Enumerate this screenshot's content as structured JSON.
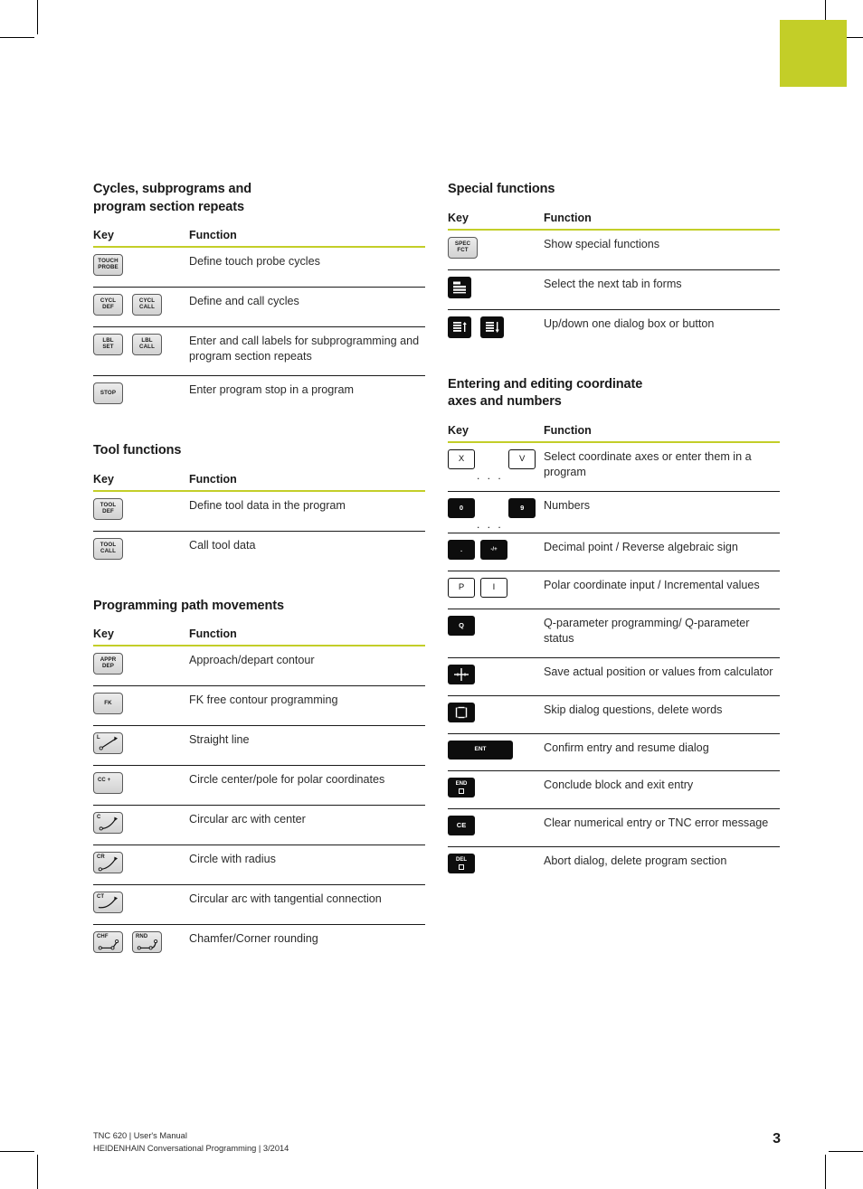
{
  "theme": {
    "accent": "#c3ce28",
    "rule": "#1a1a1a",
    "gray_key_fill": "#dcdcdc",
    "black_key_fill": "#0d0d0d",
    "text": "#1a1a1a"
  },
  "table_headers": {
    "key": "Key",
    "function": "Function"
  },
  "left_column": {
    "sections": [
      {
        "title": "Cycles, subprograms and\nprogram section repeats",
        "rows": [
          {
            "keys": [
              {
                "style": "gray",
                "lines": [
                  "TOUCH",
                  "PROBE"
                ]
              }
            ],
            "function": "Define touch probe cycles"
          },
          {
            "keys": [
              {
                "style": "gray",
                "lines": [
                  "CYCL",
                  "DEF"
                ]
              },
              {
                "style": "gray",
                "lines": [
                  "CYCL",
                  "CALL"
                ]
              }
            ],
            "function": "Define and call cycles"
          },
          {
            "keys": [
              {
                "style": "gray",
                "lines": [
                  "LBL",
                  "SET"
                ]
              },
              {
                "style": "gray",
                "lines": [
                  "LBL",
                  "CALL"
                ]
              }
            ],
            "function": "Enter and call labels for subprogramming and program section repeats"
          },
          {
            "keys": [
              {
                "style": "gray",
                "lines": [
                  "STOP"
                ]
              }
            ],
            "function": "Enter program stop in a program"
          }
        ]
      },
      {
        "title": "Tool functions",
        "rows": [
          {
            "keys": [
              {
                "style": "gray",
                "lines": [
                  "TOOL",
                  "DEF"
                ]
              }
            ],
            "function": "Define tool data in the program"
          },
          {
            "keys": [
              {
                "style": "gray",
                "lines": [
                  "TOOL",
                  "CALL"
                ]
              }
            ],
            "function": "Call tool data"
          }
        ]
      },
      {
        "title": "Programming path movements",
        "rows": [
          {
            "keys": [
              {
                "style": "gray",
                "lines": [
                  "APPR",
                  "DEP"
                ]
              }
            ],
            "function": "Approach/depart contour"
          },
          {
            "keys": [
              {
                "style": "gray",
                "lines": [
                  "FK"
                ]
              }
            ],
            "function": "FK free contour programming"
          },
          {
            "keys": [
              {
                "style": "gray-glyph",
                "tag": "L",
                "glyph": "straight-line"
              }
            ],
            "function": "Straight line"
          },
          {
            "keys": [
              {
                "style": "gray-glyph",
                "tag": "CC +",
                "glyph": "pole-cross"
              }
            ],
            "function": "Circle center/pole for polar coordinates"
          },
          {
            "keys": [
              {
                "style": "gray-glyph",
                "tag": "C",
                "glyph": "arc-center"
              }
            ],
            "function": "Circular arc with center"
          },
          {
            "keys": [
              {
                "style": "gray-glyph",
                "tag": "CR",
                "glyph": "arc-radius"
              }
            ],
            "function": "Circle with radius"
          },
          {
            "keys": [
              {
                "style": "gray-glyph",
                "tag": "CT",
                "glyph": "arc-tangential"
              }
            ],
            "function": "Circular arc with tangential connection"
          },
          {
            "keys": [
              {
                "style": "gray-glyph",
                "tag": "CHF",
                "glyph": "chamfer"
              },
              {
                "style": "gray-glyph",
                "tag": "RND",
                "glyph": "rounding"
              }
            ],
            "function": "Chamfer/Corner rounding"
          }
        ]
      }
    ]
  },
  "right_column": {
    "sections": [
      {
        "title": "Special functions",
        "rows": [
          {
            "keys": [
              {
                "style": "gray",
                "lines": [
                  "SPEC",
                  "FCT"
                ]
              }
            ],
            "function": "Show special functions"
          },
          {
            "keys": [
              {
                "style": "black-icon",
                "glyph": "next-tab-icon"
              }
            ],
            "function": "Select the next tab in forms"
          },
          {
            "keys": [
              {
                "style": "black-icon",
                "glyph": "dialog-up-icon"
              },
              {
                "style": "black-icon",
                "glyph": "dialog-down-icon"
              }
            ],
            "function": "Up/down one dialog box or button"
          }
        ]
      },
      {
        "title": "Entering and editing coordinate\naxes and numbers",
        "rows": [
          {
            "keys": [
              {
                "style": "white",
                "label": "X"
              },
              {
                "style": "dots",
                "label": ". . ."
              },
              {
                "style": "white",
                "label": "V"
              }
            ],
            "function": "Select coordinate axes or enter them in a program"
          },
          {
            "keys": [
              {
                "style": "black",
                "label": "0"
              },
              {
                "style": "dots",
                "label": ". . ."
              },
              {
                "style": "black",
                "label": "9"
              }
            ],
            "function": "Numbers"
          },
          {
            "keys": [
              {
                "style": "black",
                "label": "."
              },
              {
                "style": "black",
                "label": "-/+"
              }
            ],
            "function": "Decimal point / Reverse algebraic sign"
          },
          {
            "keys": [
              {
                "style": "white",
                "label": "P"
              },
              {
                "style": "white",
                "label": "I"
              }
            ],
            "function": "Polar coordinate input / Incremental values"
          },
          {
            "keys": [
              {
                "style": "black",
                "label": "Q"
              }
            ],
            "function": "Q-parameter programming/ Q-parameter status"
          },
          {
            "keys": [
              {
                "style": "black-icon",
                "glyph": "crosshair-icon"
              }
            ],
            "function": "Save actual position or values from calculator"
          },
          {
            "keys": [
              {
                "style": "black-icon",
                "glyph": "no-entry-icon"
              }
            ],
            "function": "Skip dialog questions, delete words"
          },
          {
            "keys": [
              {
                "style": "black-ent",
                "label": "ENT"
              }
            ],
            "function": "Confirm entry and resume dialog"
          },
          {
            "keys": [
              {
                "style": "black-box",
                "label": "END"
              }
            ],
            "function": "Conclude block and exit entry"
          },
          {
            "keys": [
              {
                "style": "black",
                "label": "CE"
              }
            ],
            "function": "Clear numerical entry or TNC error message"
          },
          {
            "keys": [
              {
                "style": "black-box",
                "label": "DEL"
              }
            ],
            "function": "Abort dialog, delete program section"
          }
        ]
      }
    ]
  },
  "footer": {
    "line1": "TNC 620 | User's Manual",
    "line2": "HEIDENHAIN Conversational Programming | 3/2014",
    "page_number": "3"
  }
}
